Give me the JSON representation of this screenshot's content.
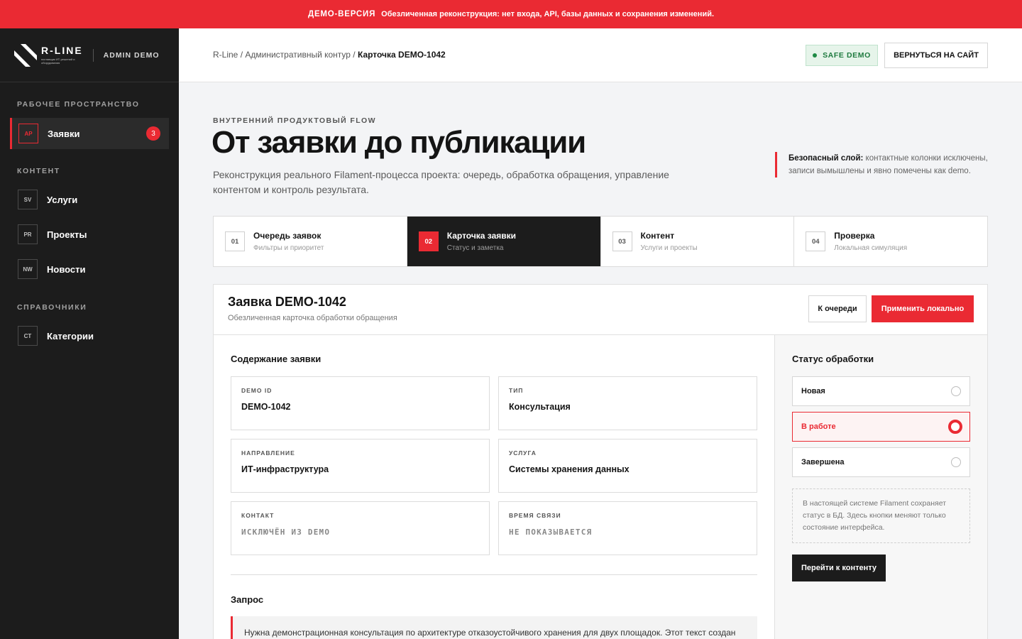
{
  "banner": {
    "tag": "ДЕМО-ВЕРСИЯ",
    "text": "Обезличенная реконструкция: нет входа, API, базы данных и сохранения изменений."
  },
  "brand": {
    "name": "R-LINE",
    "tagline": "поставщик ИТ-решений и оборудования",
    "admin_label": "ADMIN DEMO"
  },
  "sidebar": {
    "sections": [
      {
        "title": "РАБОЧЕЕ ПРОСТРАНСТВО"
      },
      {
        "title": "КОНТЕНТ"
      },
      {
        "title": "СПРАВОЧНИКИ"
      }
    ],
    "items": [
      {
        "code": "AP",
        "label": "Заявки",
        "badge": "3"
      },
      {
        "code": "SV",
        "label": "Услуги"
      },
      {
        "code": "PR",
        "label": "Проекты"
      },
      {
        "code": "NW",
        "label": "Новости"
      },
      {
        "code": "CT",
        "label": "Категории"
      }
    ]
  },
  "topbar": {
    "breadcrumb_1": "R-Line",
    "breadcrumb_2": "Административный контур",
    "breadcrumb_current": "Карточка DEMO-1042",
    "sep": " / ",
    "safe_badge": "SAFE DEMO",
    "back_button": "ВЕРНУТЬСЯ НА САЙТ"
  },
  "hero": {
    "eyebrow": "ВНУТРЕННИЙ ПРОДУКТОВЫЙ FLOW",
    "title": "От заявки до публикации",
    "description": "Реконструкция реального Filament-процесса проекта: очередь, обработка обращения, управление контентом и контроль результата.",
    "note_bold": "Безопасный слой:",
    "note_text": " контактные колонки исключены, записи вымышлены и явно помечены как demo."
  },
  "steps": [
    {
      "num": "01",
      "title": "Очередь заявок",
      "sub": "Фильтры и приоритет"
    },
    {
      "num": "02",
      "title": "Карточка заявки",
      "sub": "Статус и заметка",
      "active": true
    },
    {
      "num": "03",
      "title": "Контент",
      "sub": "Услуги и проекты"
    },
    {
      "num": "04",
      "title": "Проверка",
      "sub": "Локальная симуляция"
    }
  ],
  "card": {
    "title": "Заявка DEMO-1042",
    "subtitle": "Обезличенная карточка обработки обращения",
    "queue_button": "К очереди",
    "apply_button": "Применить локально",
    "content_heading": "Содержание заявки",
    "fields": [
      {
        "label": "DEMO ID",
        "value": "DEMO-1042"
      },
      {
        "label": "ТИП",
        "value": "Консультация"
      },
      {
        "label": "НАПРАВЛЕНИЕ",
        "value": "ИТ-инфраструктура"
      },
      {
        "label": "УСЛУГА",
        "value": "Системы хранения данных"
      },
      {
        "label": "КОНТАКТ",
        "value": "ИСКЛЮЧЁН ИЗ DEMO"
      },
      {
        "label": "ВРЕМЯ СВЯЗИ",
        "value": "НЕ ПОКАЗЫВАЕТСЯ"
      }
    ],
    "request_heading": "Запрос",
    "request_text": "Нужна демонстрационная консультация по архитектуре отказоустойчивого хранения для двух площадок. Этот текст создан"
  },
  "status": {
    "heading": "Статус обработки",
    "options": [
      {
        "label": "Новая"
      },
      {
        "label": "В работе",
        "selected": true
      },
      {
        "label": "Завершена"
      }
    ],
    "note": "В настоящей системе Filament сохраняет статус в БД. Здесь кнопки меняют только состояние интерфейса.",
    "go_button": "Перейти к контенту"
  },
  "colors": {
    "accent": "#ea2a33",
    "sidebar_bg": "#1c1c1c",
    "safe_green": "#1e7a3f"
  }
}
